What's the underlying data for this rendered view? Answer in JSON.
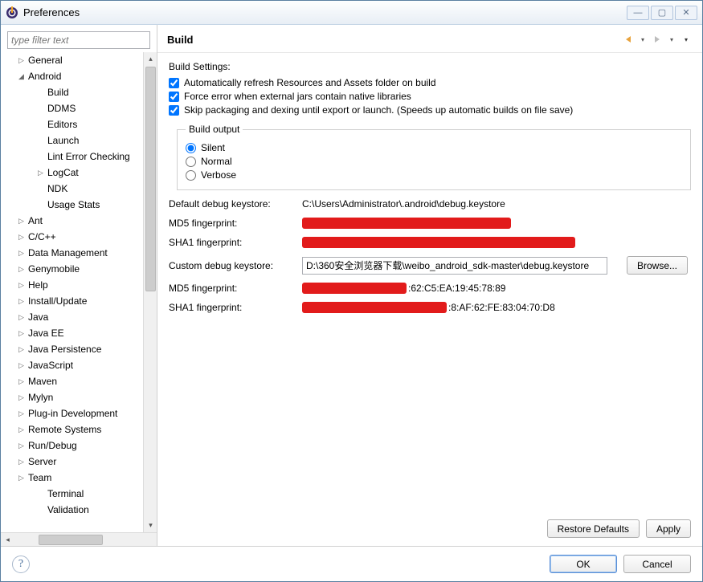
{
  "window": {
    "title": "Preferences"
  },
  "filter": {
    "placeholder": "type filter text"
  },
  "tree": [
    {
      "label": "General",
      "depth": 1,
      "arrow": "▷"
    },
    {
      "label": "Android",
      "depth": 1,
      "arrow": "◢"
    },
    {
      "label": "Build",
      "depth": 2,
      "arrow": ""
    },
    {
      "label": "DDMS",
      "depth": 2,
      "arrow": ""
    },
    {
      "label": "Editors",
      "depth": 2,
      "arrow": ""
    },
    {
      "label": "Launch",
      "depth": 2,
      "arrow": ""
    },
    {
      "label": "Lint Error Checking",
      "depth": 2,
      "arrow": ""
    },
    {
      "label": "LogCat",
      "depth": 2,
      "arrow": "▷"
    },
    {
      "label": "NDK",
      "depth": 2,
      "arrow": ""
    },
    {
      "label": "Usage Stats",
      "depth": 2,
      "arrow": ""
    },
    {
      "label": "Ant",
      "depth": 1,
      "arrow": "▷"
    },
    {
      "label": "C/C++",
      "depth": 1,
      "arrow": "▷"
    },
    {
      "label": "Data Management",
      "depth": 1,
      "arrow": "▷"
    },
    {
      "label": "Genymobile",
      "depth": 1,
      "arrow": "▷"
    },
    {
      "label": "Help",
      "depth": 1,
      "arrow": "▷"
    },
    {
      "label": "Install/Update",
      "depth": 1,
      "arrow": "▷"
    },
    {
      "label": "Java",
      "depth": 1,
      "arrow": "▷"
    },
    {
      "label": "Java EE",
      "depth": 1,
      "arrow": "▷"
    },
    {
      "label": "Java Persistence",
      "depth": 1,
      "arrow": "▷"
    },
    {
      "label": "JavaScript",
      "depth": 1,
      "arrow": "▷"
    },
    {
      "label": "Maven",
      "depth": 1,
      "arrow": "▷"
    },
    {
      "label": "Mylyn",
      "depth": 1,
      "arrow": "▷"
    },
    {
      "label": "Plug-in Development",
      "depth": 1,
      "arrow": "▷"
    },
    {
      "label": "Remote Systems",
      "depth": 1,
      "arrow": "▷"
    },
    {
      "label": "Run/Debug",
      "depth": 1,
      "arrow": "▷"
    },
    {
      "label": "Server",
      "depth": 1,
      "arrow": "▷"
    },
    {
      "label": "Team",
      "depth": 1,
      "arrow": "▷"
    },
    {
      "label": "Terminal",
      "depth": 2,
      "arrow": ""
    },
    {
      "label": "Validation",
      "depth": 2,
      "arrow": ""
    }
  ],
  "page": {
    "title": "Build",
    "settings_label": "Build Settings:",
    "chk1": "Automatically refresh Resources and Assets folder on build",
    "chk2": "Force error when external jars contain native libraries",
    "chk3": "Skip packaging and dexing until export or launch. (Speeds up automatic builds on file save)",
    "build_output_legend": "Build output",
    "radio_silent": "Silent",
    "radio_normal": "Normal",
    "radio_verbose": "Verbose",
    "default_keystore_label": "Default debug keystore:",
    "default_keystore_value": "C:\\Users\\Administrator\\.android\\debug.keystore",
    "md5_label": "MD5 fingerprint:",
    "sha1_label": "SHA1 fingerprint:",
    "custom_keystore_label": "Custom debug keystore:",
    "custom_keystore_value": "D:\\360安全浏览器下载\\weibo_android_sdk-master\\debug.keystore",
    "browse_label": "Browse...",
    "md5_custom_suffix": ":62:C5:EA:19:45:78:89",
    "sha1_custom_suffix": ":8:AF:62:FE:83:04:70:D8",
    "restore_label": "Restore Defaults",
    "apply_label": "Apply"
  },
  "dialog": {
    "ok": "OK",
    "cancel": "Cancel"
  }
}
